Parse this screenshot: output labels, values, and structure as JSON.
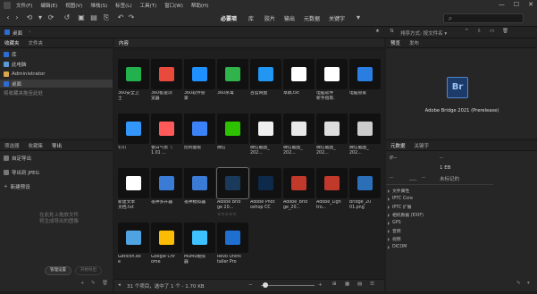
{
  "menu": [
    "文件(F)",
    "编辑(E)",
    "视图(V)",
    "堆栈(S)",
    "标签(L)",
    "工具(T)",
    "窗口(W)",
    "帮助(H)"
  ],
  "workspaces": [
    "必要项",
    "库",
    "胶片",
    "输出",
    "元数据",
    "关键字"
  ],
  "path": {
    "label": "桌面"
  },
  "left_top": {
    "tabs": [
      "收藏夹",
      "文件夹"
    ],
    "items": [
      "库",
      "此电脑",
      "Administrator",
      "桌面"
    ],
    "hint": "将收藏夹拖至此处"
  },
  "left_bottom": {
    "tabs": [
      "筛选器",
      "收藏集",
      "导出"
    ],
    "items": [
      "自定导出",
      "导出到 JPEG",
      "新建预设"
    ],
    "drop_hint": "在此处上拖放文件\n将生成导出的图像",
    "buttons": {
      "save": "管理设置",
      "export": "开始导出"
    }
  },
  "content": {
    "tab": "内容",
    "thumbs": [
      {
        "label": "360安全卫\n士",
        "color": "#22b14c"
      },
      {
        "label": "360极速浏\n览器",
        "color": "#e84b3c"
      },
      {
        "label": "360软件管\n家",
        "color": "#1e90ff"
      },
      {
        "label": "360杀毒",
        "color": "#2fb34a"
      },
      {
        "label": "百度网盘",
        "color": "#2196f3"
      },
      {
        "label": "草稿.txt",
        "color": "#ffffff"
      },
      {
        "label": "电脑软件\n新手指南.",
        "color": "#ffffff"
      },
      {
        "label": "电脑管家",
        "color": "#2a7de1"
      },
      {
        "label": "钉钉",
        "color": "#3296fa"
      },
      {
        "label": "鲁白气泵（\n1.01 ...",
        "color": "#ff5a5a"
      },
      {
        "label": "控制面板",
        "color": "#3b82f6"
      },
      {
        "label": "微信",
        "color": "#2dc100"
      },
      {
        "label": "微信截图_\n202...",
        "color": "#f0f0f0"
      },
      {
        "label": "微信截图_\n202...",
        "color": "#e8e8e8"
      },
      {
        "label": "微信截图_\n202...",
        "color": "#dddddd"
      },
      {
        "label": "微信截图_\n202...",
        "color": "#cccccc"
      },
      {
        "label": "新建文本\n文档.txt",
        "color": "#ffffff"
      },
      {
        "label": "夜神多开器",
        "color": "#3a7bd5"
      },
      {
        "label": "夜神模拟器",
        "color": "#3a7bd5"
      },
      {
        "label": "Adobe Brid\nge 20...",
        "color": "#1a3a5c"
      },
      {
        "label": "Adobe Phot\noshop CC",
        "color": "#0d2a4a"
      },
      {
        "label": "Adobe_Brid\nge_20...",
        "color": "#c0392b"
      },
      {
        "label": "Adobe_Ligh\ntro...",
        "color": "#c0392b"
      },
      {
        "label": "Bridge_20\n01.png",
        "color": "#2a6fb8"
      },
      {
        "label": "Getlcon.ex\ne",
        "color": "#4fa3e0"
      },
      {
        "label": "Google Chr\nome",
        "color": "#fbbc05"
      },
      {
        "label": "MuMu模拟\n器",
        "color": "#3dc2ff"
      },
      {
        "label": "Revo Unins\ntaller Pro",
        "color": "#1f6fd0"
      }
    ],
    "stars": "☆☆☆☆☆",
    "status": "31 个项目，选中了 1 个 - 1.70 KB"
  },
  "preview": {
    "tabs": [
      "预览",
      "发布"
    ],
    "app_name": "Adobe Bridge 2021 (Prerelease)",
    "icon_text": "Br"
  },
  "metadata": {
    "tabs": [
      "元数据",
      "关键字"
    ],
    "summary": {
      "f": "f/--",
      "dash1": "--",
      "dash2": "--",
      "iso": "--",
      "eb": "1 EB",
      "unmarked": "未标记的"
    },
    "sections": [
      "文件属性",
      "IPTC Core",
      "IPTC 扩展",
      "相机数据 (EXIF)",
      "GPS",
      "音频",
      "视频",
      "DICOM"
    ]
  },
  "colors": {
    "accent": "#2d6dd1",
    "bg": "#1e1e1e",
    "panel": "#262626"
  }
}
